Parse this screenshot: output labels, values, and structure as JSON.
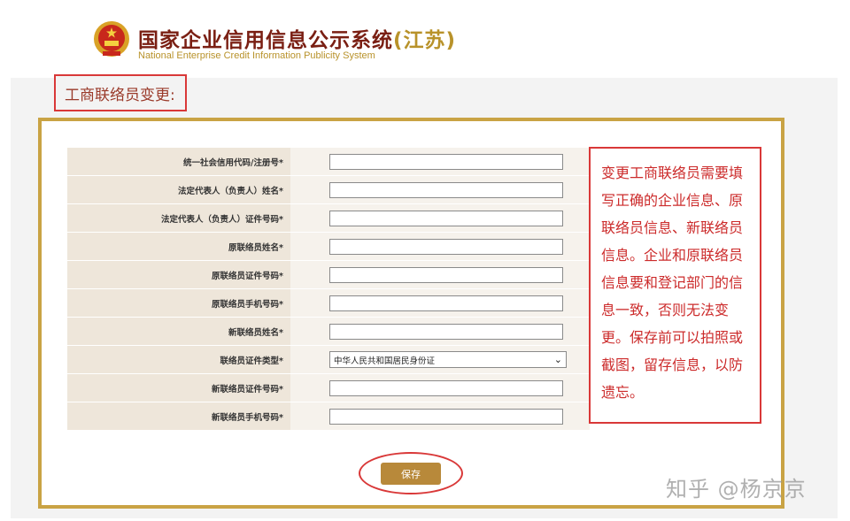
{
  "header": {
    "title_main": "国家企业信用信息公示系统",
    "title_province": "(江苏)",
    "subtitle": "National Enterprise Credit Information Publicity System"
  },
  "section_title": "工商联络员变更:",
  "form": {
    "rows": [
      {
        "label": "统一社会信用代码/注册号*",
        "type": "input",
        "value": ""
      },
      {
        "label": "法定代表人（负责人）姓名*",
        "type": "input",
        "value": ""
      },
      {
        "label": "法定代表人（负责人）证件号码*",
        "type": "input",
        "value": ""
      },
      {
        "label": "原联络员姓名*",
        "type": "input",
        "value": ""
      },
      {
        "label": "原联络员证件号码*",
        "type": "input",
        "value": ""
      },
      {
        "label": "原联络员手机号码*",
        "type": "input",
        "value": ""
      },
      {
        "label": "新联络员姓名*",
        "type": "input",
        "value": ""
      },
      {
        "label": "联络员证件类型*",
        "type": "select",
        "value": "中华人民共和国居民身份证"
      },
      {
        "label": "新联络员证件号码*",
        "type": "input",
        "value": ""
      },
      {
        "label": "新联络员手机号码*",
        "type": "input",
        "value": ""
      }
    ],
    "save_label": "保存"
  },
  "note": "变更工商联络员需要填写正确的企业信息、原联络员信息、新联络员信息。企业和原联络员信息要和登记部门的信息一致，否则无法变更。保存前可以拍照或截图，留存信息，以防遗忘。",
  "watermark": "知乎 @杨京京",
  "colors": {
    "brand_red": "#7a1f13",
    "gold": "#c9a344",
    "annotation_red": "#d93838",
    "save_button": "#b8893a"
  }
}
